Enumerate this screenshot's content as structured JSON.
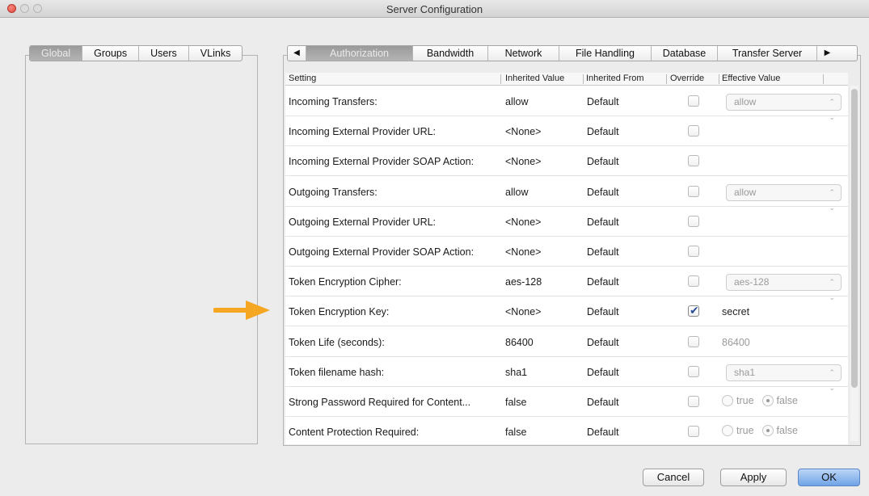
{
  "window": {
    "title": "Server Configuration"
  },
  "left": {
    "tabs": [
      "Global",
      "Groups",
      "Users",
      "VLinks"
    ],
    "active_tab": "Global"
  },
  "right": {
    "scroll_left_arrow": "◀",
    "scroll_right_arrow": "▶",
    "tabs": [
      "Authorization",
      "Bandwidth",
      "Network",
      "File Handling",
      "Database",
      "Transfer Server"
    ],
    "active_tab": "Authorization"
  },
  "table": {
    "headers": [
      "Setting",
      "Inherited Value",
      "Inherited From",
      "Override",
      "Effective Value"
    ],
    "rows": [
      {
        "setting": "Incoming Transfers:",
        "inherited_value": "allow",
        "inherited_from": "Default",
        "override": false,
        "effective_kind": "select",
        "effective": "allow"
      },
      {
        "setting": "Incoming External Provider URL:",
        "inherited_value": "<None>",
        "inherited_from": "Default",
        "override": false,
        "effective_kind": "none",
        "effective": ""
      },
      {
        "setting": "Incoming External Provider SOAP Action:",
        "inherited_value": "<None>",
        "inherited_from": "Default",
        "override": false,
        "effective_kind": "none",
        "effective": ""
      },
      {
        "setting": "Outgoing Transfers:",
        "inherited_value": "allow",
        "inherited_from": "Default",
        "override": false,
        "effective_kind": "select",
        "effective": "allow"
      },
      {
        "setting": "Outgoing External Provider URL:",
        "inherited_value": "<None>",
        "inherited_from": "Default",
        "override": false,
        "effective_kind": "none",
        "effective": ""
      },
      {
        "setting": "Outgoing External Provider SOAP Action:",
        "inherited_value": "<None>",
        "inherited_from": "Default",
        "override": false,
        "effective_kind": "none",
        "effective": ""
      },
      {
        "setting": "Token Encryption Cipher:",
        "inherited_value": "aes-128",
        "inherited_from": "Default",
        "override": false,
        "effective_kind": "select",
        "effective": "aes-128"
      },
      {
        "setting": "Token Encryption Key:",
        "inherited_value": "<None>",
        "inherited_from": "Default",
        "override": true,
        "effective_kind": "text",
        "effective": "secret"
      },
      {
        "setting": "Token Life (seconds):",
        "inherited_value": "86400",
        "inherited_from": "Default",
        "override": false,
        "effective_kind": "dimtext",
        "effective": "86400"
      },
      {
        "setting": "Token filename hash:",
        "inherited_value": "sha1",
        "inherited_from": "Default",
        "override": false,
        "effective_kind": "select",
        "effective": "sha1"
      },
      {
        "setting": "Strong Password Required for Content...",
        "inherited_value": "false",
        "inherited_from": "Default",
        "override": false,
        "effective_kind": "radio",
        "radio_options": [
          "true",
          "false"
        ],
        "effective": "false"
      },
      {
        "setting": "Content Protection Required:",
        "inherited_value": "false",
        "inherited_from": "Default",
        "override": false,
        "effective_kind": "radio",
        "radio_options": [
          "true",
          "false"
        ],
        "effective": "false"
      }
    ]
  },
  "buttons": {
    "cancel": "Cancel",
    "apply": "Apply",
    "ok": "OK"
  },
  "colors": {
    "annotation_arrow": "#f5a623",
    "primary_button": "#6fa3e6",
    "checkbox_tick": "#2a4f96"
  }
}
